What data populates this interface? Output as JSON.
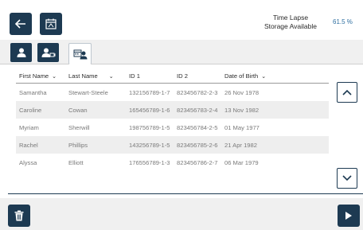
{
  "header": {
    "back_icon": "arrow-left-icon",
    "calendar_icon": "calendar-icon",
    "storage_title": "Time Lapse",
    "storage_subtitle": "Storage Available",
    "storage_value": "61.5 %"
  },
  "tabs": [
    {
      "icon": "user-icon",
      "active": false
    },
    {
      "icon": "user-camera-icon",
      "active": false
    },
    {
      "icon": "user-calendar-icon",
      "active": true
    }
  ],
  "table": {
    "columns": [
      "First Name",
      "Last Name",
      "ID 1",
      "ID 2",
      "Date of Birth"
    ],
    "rows": [
      [
        "Samantha",
        "Stewart-Steele",
        "132156789-1-7",
        "823456782-2-3",
        "26 Nov 1978"
      ],
      [
        "Caroline",
        "Cowan",
        "165456789-1-6",
        "823456783-2-4",
        "13 Nov 1982"
      ],
      [
        "Myriam",
        "Sherwill",
        "198756789-1-5",
        "823456784-2-5",
        "01 May 1977"
      ],
      [
        "Rachel",
        "Phillips",
        "143256789-1-5",
        "823456785-2-6",
        "21 Apr 1982"
      ],
      [
        "Alyssa",
        "Elliott",
        "176556789-1-3",
        "823456786-2-7",
        "06 Mar 1979"
      ]
    ]
  },
  "scroll": {
    "up_icon": "chevron-up-icon",
    "down_icon": "chevron-down-icon"
  },
  "footer": {
    "delete_icon": "trash-icon",
    "next_icon": "play-icon"
  },
  "colors": {
    "navy": "#1d3a52",
    "accent": "#2e6fa0"
  }
}
